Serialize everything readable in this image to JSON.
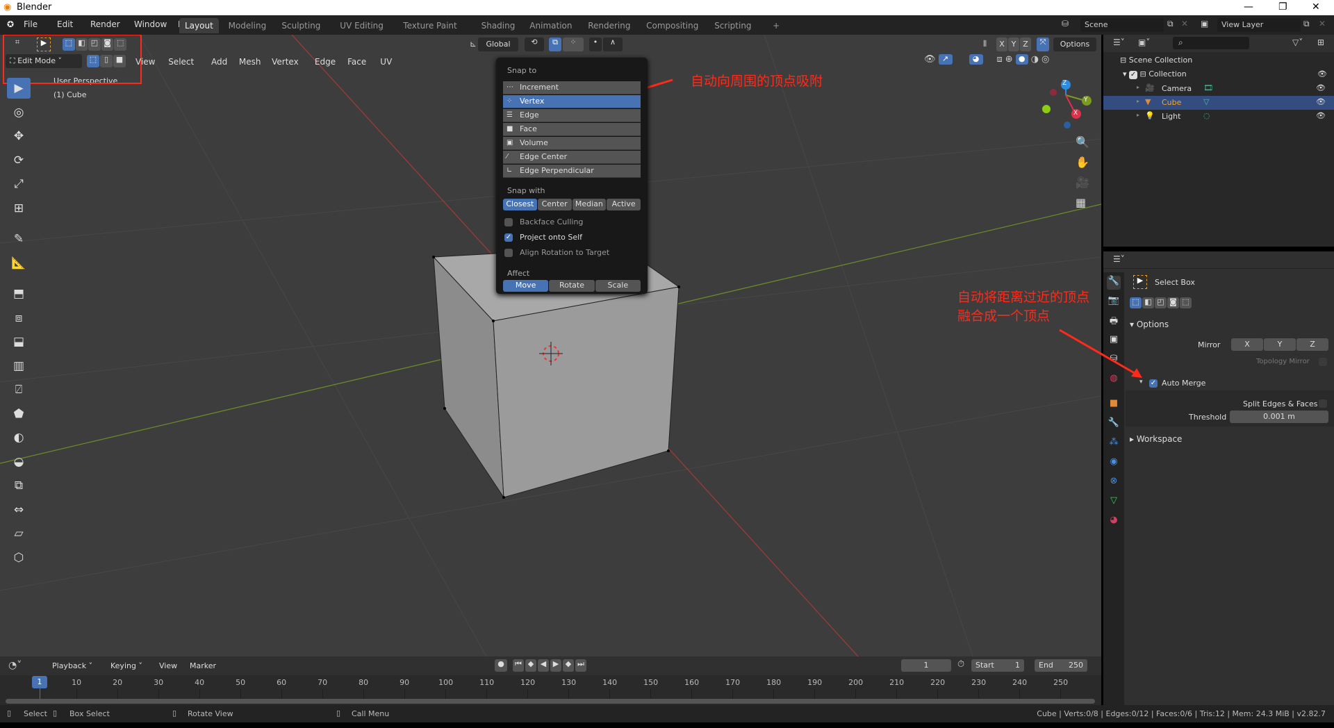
{
  "window": {
    "title": "Blender",
    "controls": [
      "—",
      "❐",
      "✕"
    ]
  },
  "topbar": {
    "menus": [
      "File",
      "Edit",
      "Render",
      "Window",
      "Help"
    ],
    "workspaces": [
      "Layout",
      "Modeling",
      "Sculpting",
      "UV Editing",
      "Texture Paint",
      "Shading",
      "Animation",
      "Rendering",
      "Compositing",
      "Scripting",
      "+"
    ],
    "active_workspace": "Layout",
    "scene": "Scene",
    "view_layer": "View Layer"
  },
  "viewport": {
    "mode": "Edit Mode",
    "menus": [
      "View",
      "Select",
      "Add",
      "Mesh",
      "Vertex",
      "Edge",
      "Face",
      "UV"
    ],
    "orientation": "Global",
    "options_label": "Options",
    "axes": [
      "X",
      "Y",
      "Z"
    ],
    "overlay_title": "User Perspective",
    "overlay_object": "(1) Cube",
    "gizmo_axes": {
      "x": "X",
      "y": "Y",
      "z": "Z"
    },
    "tools": [
      "select-box",
      "cursor",
      "move",
      "rotate",
      "scale",
      "transform",
      "annotate",
      "measure",
      "extrude",
      "inset",
      "bevel",
      "loop-cut",
      "knife",
      "poly-build",
      "spin",
      "smooth",
      "edge-slide",
      "shrink-fatten",
      "shear",
      "rip"
    ]
  },
  "snap_popup": {
    "snap_to_label": "Snap to",
    "snap_to": [
      {
        "label": "Increment",
        "icon": "increment"
      },
      {
        "label": "Vertex",
        "icon": "vertex",
        "selected": true
      },
      {
        "label": "Edge",
        "icon": "edge"
      },
      {
        "label": "Face",
        "icon": "face"
      },
      {
        "label": "Volume",
        "icon": "volume"
      },
      {
        "label": "Edge Center",
        "icon": "edge-center"
      },
      {
        "label": "Edge Perpendicular",
        "icon": "edge-perpendicular"
      }
    ],
    "snap_with_label": "Snap with",
    "snap_with": [
      "Closest",
      "Center",
      "Median",
      "Active"
    ],
    "snap_with_active": "Closest",
    "checks": [
      {
        "label": "Backface Culling",
        "checked": false
      },
      {
        "label": "Project onto Self",
        "checked": true
      },
      {
        "label": "Align Rotation to Target",
        "checked": false
      }
    ],
    "affect_label": "Affect",
    "affect": [
      "Move",
      "Rotate",
      "Scale"
    ],
    "affect_active": "Move"
  },
  "outliner": {
    "root": "Scene Collection",
    "collection": "Collection",
    "items": [
      {
        "name": "Camera",
        "selected": false
      },
      {
        "name": "Cube",
        "selected": true
      },
      {
        "name": "Light",
        "selected": false
      }
    ]
  },
  "properties": {
    "tool_name": "Select Box",
    "options_label": "Options",
    "mirror_label": "Mirror",
    "mirror_axes": [
      "X",
      "Y",
      "Z"
    ],
    "topology_mirror": "Topology Mirror",
    "auto_merge": "Auto Merge",
    "auto_merge_checked": true,
    "split_edges": "Split Edges & Faces",
    "threshold_label": "Threshold",
    "threshold_value": "0.001 m",
    "workspace_label": "Workspace"
  },
  "timeline": {
    "menus": [
      "Playback",
      "Keying",
      "View",
      "Marker"
    ],
    "current_frame": "1",
    "start_label": "Start",
    "start": "1",
    "end_label": "End",
    "end": "250",
    "ticks": [
      "10",
      "20",
      "30",
      "40",
      "50",
      "60",
      "70",
      "80",
      "90",
      "100",
      "110",
      "120",
      "130",
      "140",
      "150",
      "160",
      "170",
      "180",
      "190",
      "200",
      "210",
      "220",
      "230",
      "240",
      "250"
    ]
  },
  "status": {
    "hints": [
      "Select",
      "Box Select",
      "Rotate View",
      "Call Menu"
    ],
    "stats": "Cube | Verts:0/8 | Edges:0/12 | Faces:0/6 | Tris:12 | Mem: 24.3 MiB | v2.82.7"
  },
  "annotations": {
    "snap_note": "自动向周围的顶点吸附",
    "merge_note_1": "自动将距离过近的顶点",
    "merge_note_2": "融合成一个顶点"
  },
  "colors": {
    "accent": "#4772b3",
    "annotation": "#ff2a1a",
    "selected_object": "#f5a623"
  }
}
